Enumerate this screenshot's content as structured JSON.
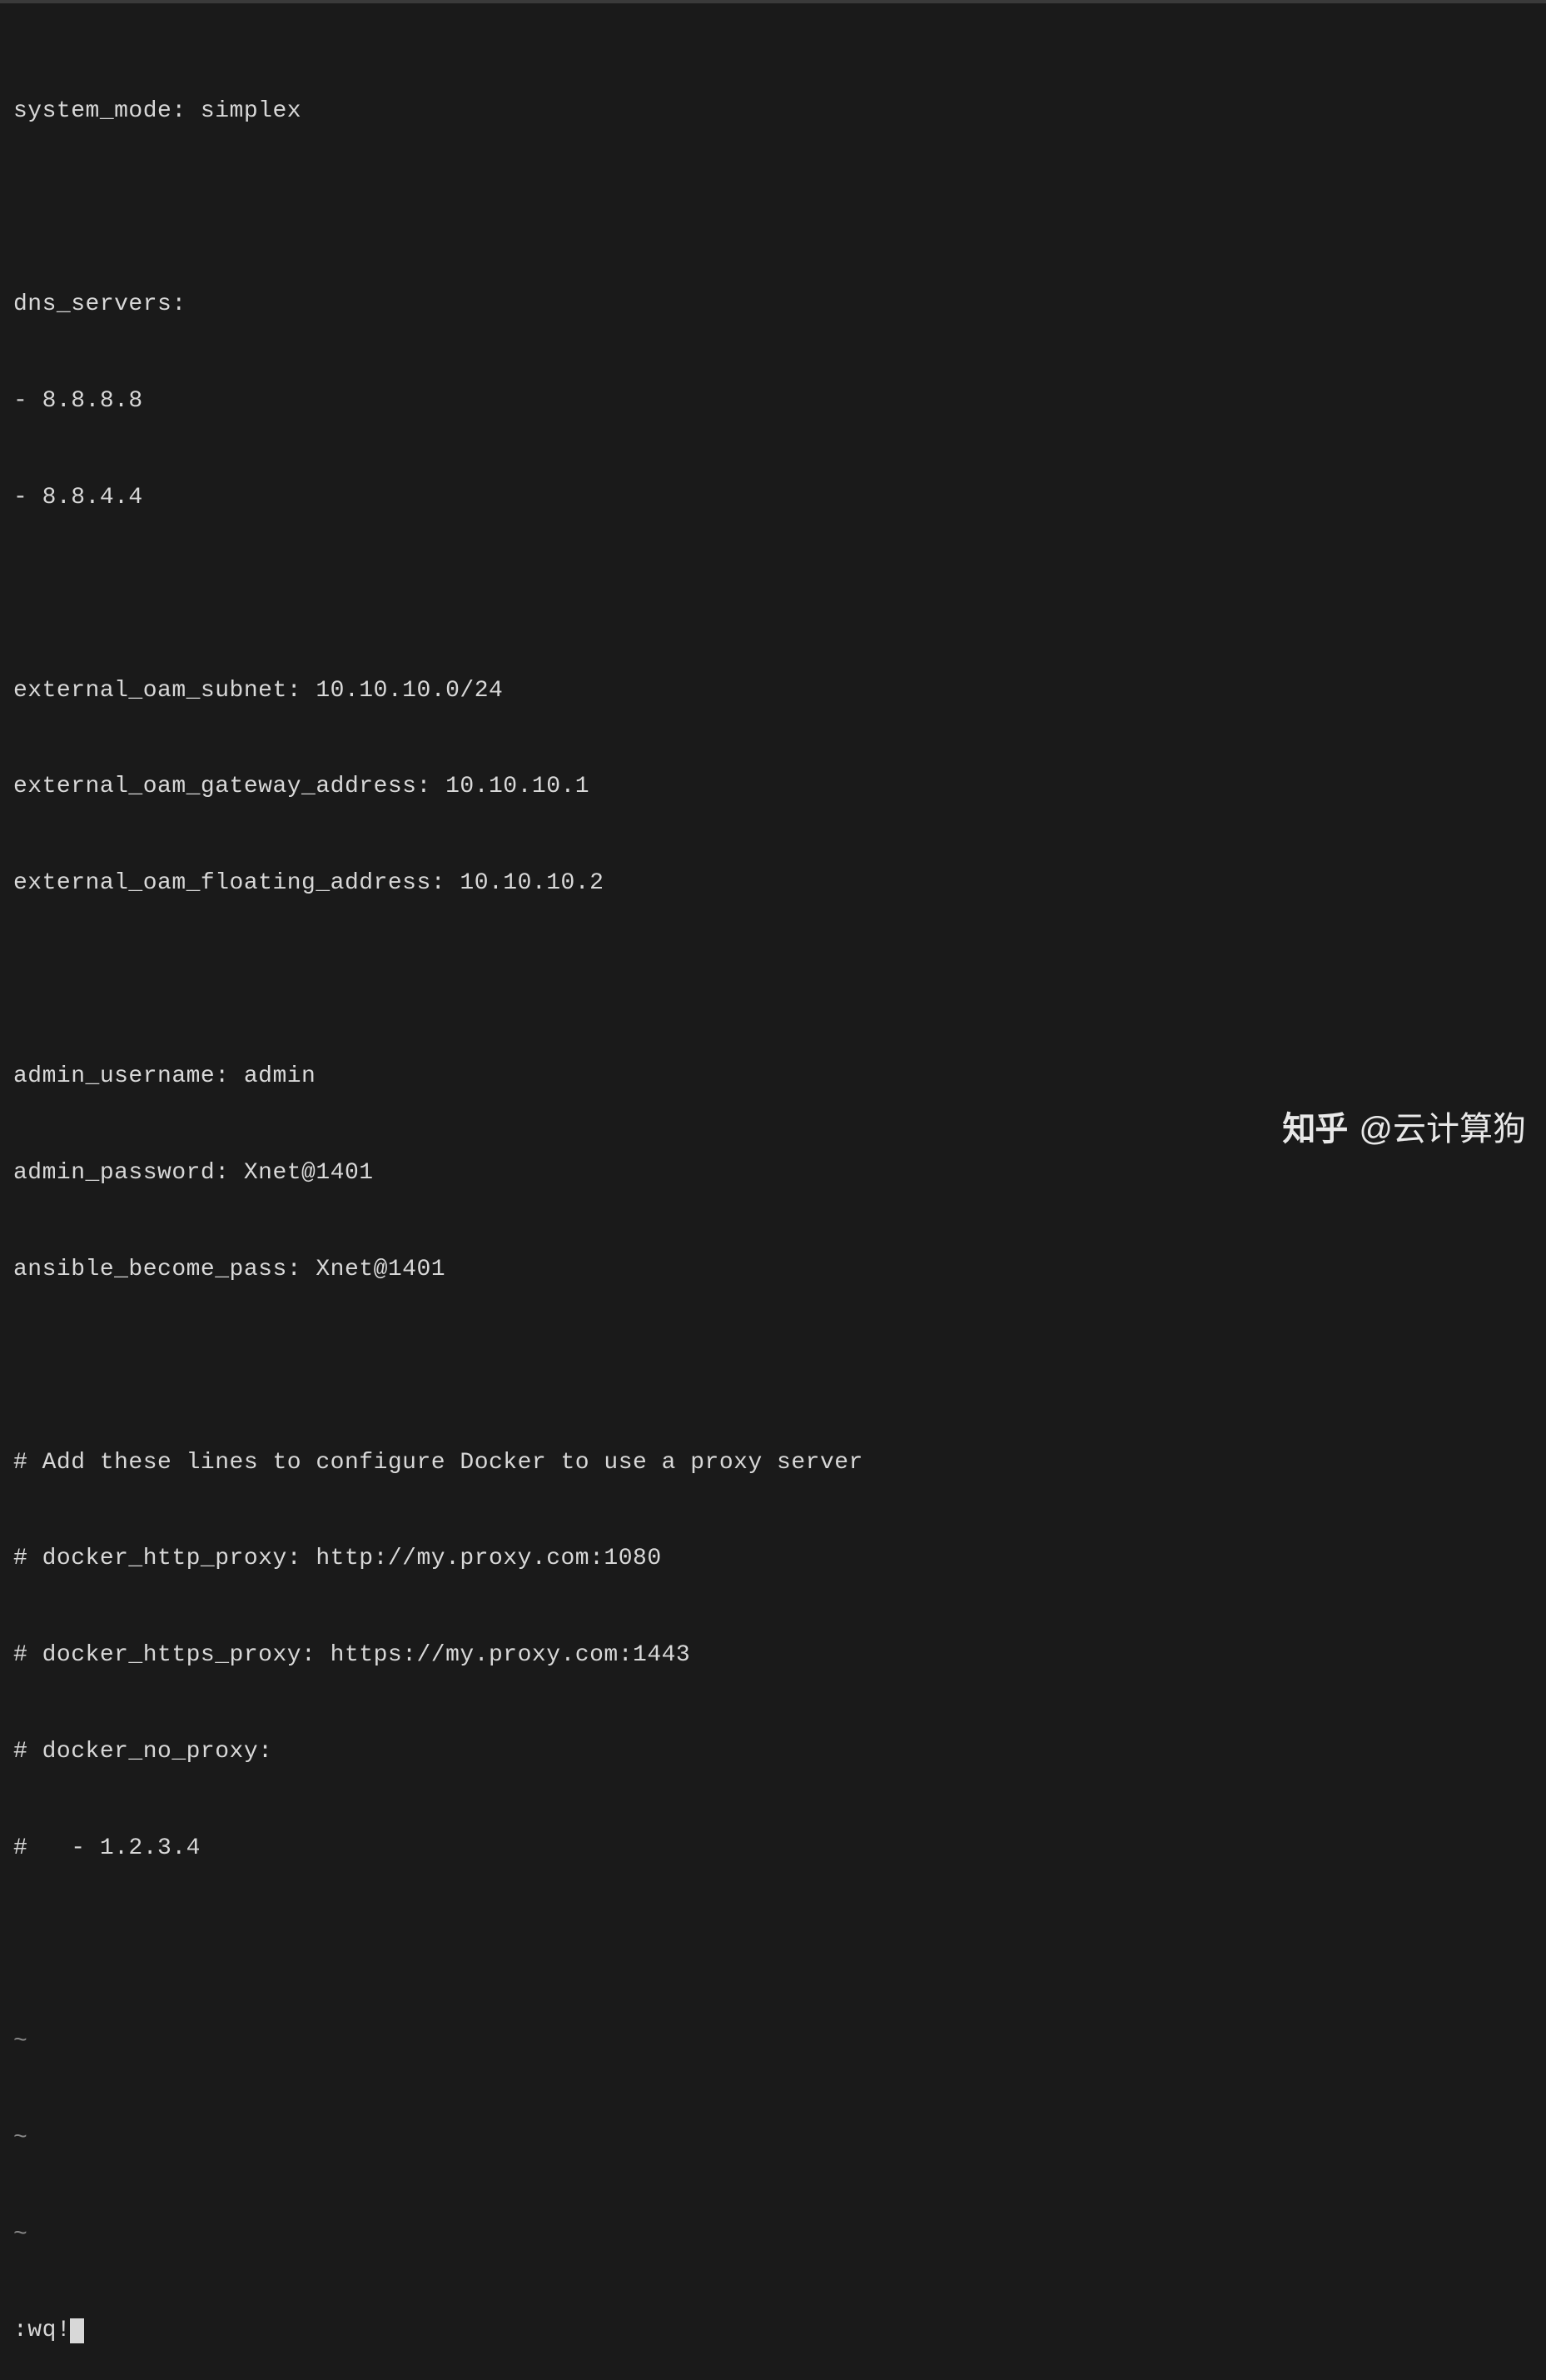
{
  "editor": {
    "lines": [
      "system_mode: simplex",
      "",
      "dns_servers:",
      "- 8.8.8.8",
      "- 8.8.4.4",
      "",
      "external_oam_subnet: 10.10.10.0/24",
      "external_oam_gateway_address: 10.10.10.1",
      "external_oam_floating_address: 10.10.10.2",
      "",
      "admin_username: admin",
      "admin_password: Xnet@1401",
      "ansible_become_pass: Xnet@1401",
      "",
      "# Add these lines to configure Docker to use a proxy server",
      "# docker_http_proxy: http://my.proxy.com:1080",
      "# docker_https_proxy: https://my.proxy.com:1443",
      "# docker_no_proxy:",
      "#   - 1.2.3.4",
      ""
    ],
    "tilde_lines": [
      "~",
      "~",
      "~"
    ],
    "command": ":wq!"
  },
  "watermark": {
    "logo": "知乎",
    "author": "@云计算狗"
  }
}
